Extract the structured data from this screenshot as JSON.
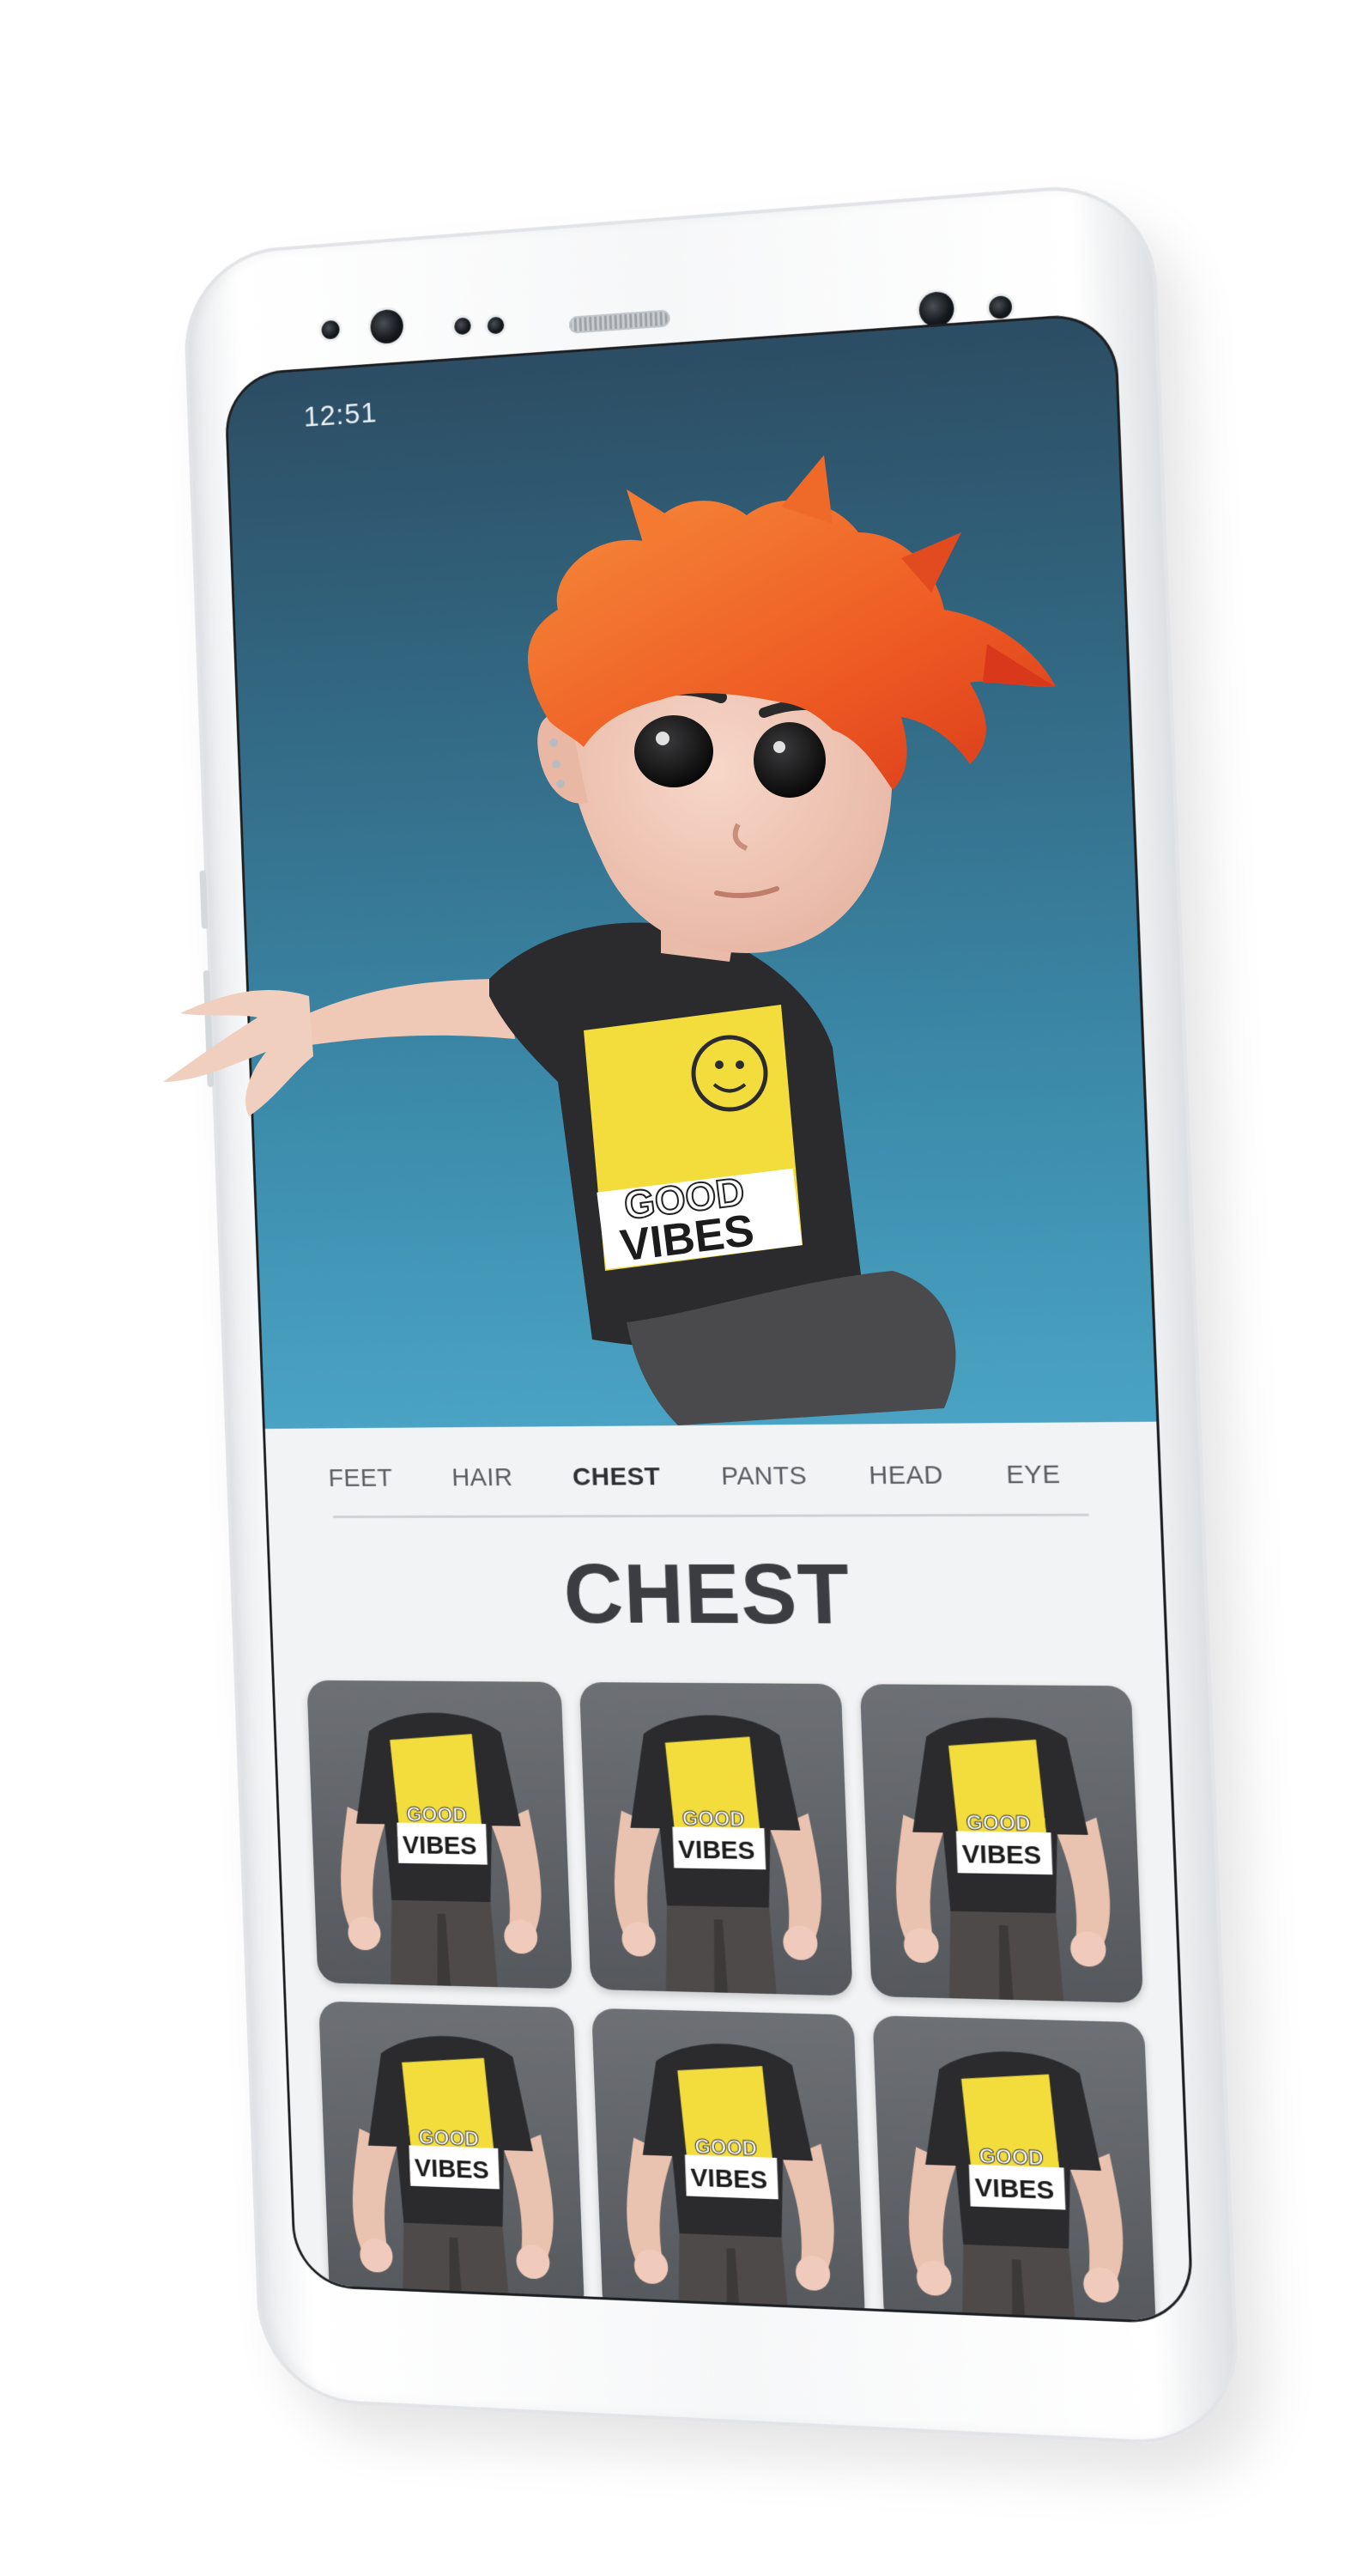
{
  "status_bar": {
    "time": "12:51"
  },
  "tabs": [
    {
      "label": "FEET",
      "active": false
    },
    {
      "label": "HAIR",
      "active": false
    },
    {
      "label": "CHEST",
      "active": true
    },
    {
      "label": "PANTS",
      "active": false
    },
    {
      "label": "HEAD",
      "active": false
    },
    {
      "label": "EYE",
      "active": false
    }
  ],
  "section_title": "CHEST",
  "items": [
    {
      "shirt_text_top": "GOOD",
      "shirt_text_bottom": "VIBES"
    },
    {
      "shirt_text_top": "GOOD",
      "shirt_text_bottom": "VIBES"
    },
    {
      "shirt_text_top": "GOOD",
      "shirt_text_bottom": "VIBES"
    },
    {
      "shirt_text_top": "GOOD",
      "shirt_text_bottom": "VIBES"
    },
    {
      "shirt_text_top": "GOOD",
      "shirt_text_bottom": "VIBES"
    },
    {
      "shirt_text_top": "GOOD",
      "shirt_text_bottom": "VIBES"
    }
  ],
  "character_shirt": {
    "text_top": "GOOD",
    "text_bottom": "VIBES"
  },
  "colors": {
    "hair": "#f2662a",
    "shirt": "#2b2b2d",
    "print": "#f2dd3c",
    "background_top": "#2c4d63",
    "background_bottom": "#4aa3c4"
  }
}
